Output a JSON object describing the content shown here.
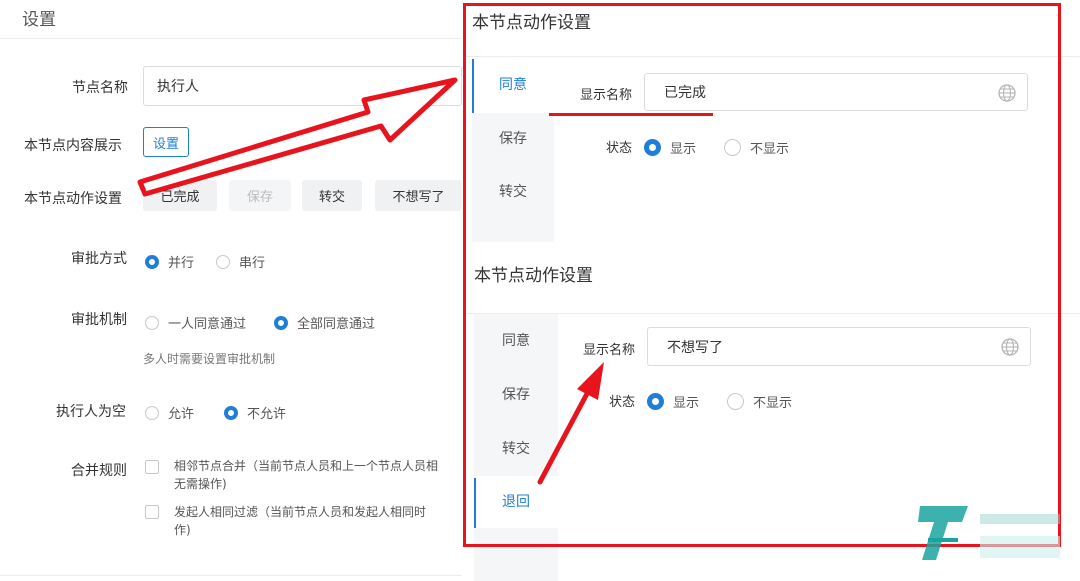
{
  "settings_panel": {
    "title": "设置",
    "node_name_label": "节点名称",
    "node_name_value": "执行人",
    "content_display_label": "本节点内容展示",
    "content_display_button": "设置",
    "actions_label": "本节点动作设置",
    "actions": [
      {
        "label": "已完成",
        "disabled": false
      },
      {
        "label": "保存",
        "disabled": true
      },
      {
        "label": "转交",
        "disabled": false
      },
      {
        "label": "不想写了",
        "disabled": false
      }
    ],
    "approval_mode_label": "审批方式",
    "approval_mode_options": [
      "并行",
      "串行"
    ],
    "approval_mode_selected": "并行",
    "approval_mechanism_label": "审批机制",
    "approval_mechanism_options": [
      "一人同意通过",
      "全部同意通过"
    ],
    "approval_mechanism_selected": "全部同意通过",
    "approval_mechanism_hint": "多人时需要设置审批机制",
    "empty_executor_label": "执行人为空",
    "empty_executor_options": [
      "允许",
      "不允许"
    ],
    "empty_executor_selected": "不允许",
    "merge_rules_label": "合并规则",
    "merge_rules": [
      {
        "line1": "相邻节点合并（当前节点人员和上一个节点人员相",
        "line2": "无需操作)",
        "checked": false
      },
      {
        "line1": "发起人相同过滤（当前节点人员和发起人相同时",
        "line2": "作)",
        "checked": false
      }
    ]
  },
  "action_panel_top": {
    "title": "本节点动作设置",
    "tabs": [
      "同意",
      "保存",
      "转交"
    ],
    "active_tab": "同意",
    "display_name_label": "显示名称",
    "display_name_value": "已完成",
    "status_label": "状态",
    "status_options": [
      "显示",
      "不显示"
    ],
    "status_selected": "显示"
  },
  "action_panel_bottom": {
    "title": "本节点动作设置",
    "tabs": [
      "同意",
      "保存",
      "转交",
      "退回"
    ],
    "active_tab": "退回",
    "display_name_label": "显示名称",
    "display_name_value": "不想写了",
    "status_label": "状态",
    "status_options": [
      "显示",
      "不显示"
    ],
    "status_selected": "显示"
  },
  "icons": {
    "globe": "globe-icon",
    "radio_checked": "radio-checked-icon",
    "radio_unchecked": "radio-unchecked-icon"
  },
  "colors": {
    "accent": "#1f7fd8",
    "annotation_red": "#e8141d",
    "watermark_teal": "#1aa3a0"
  }
}
